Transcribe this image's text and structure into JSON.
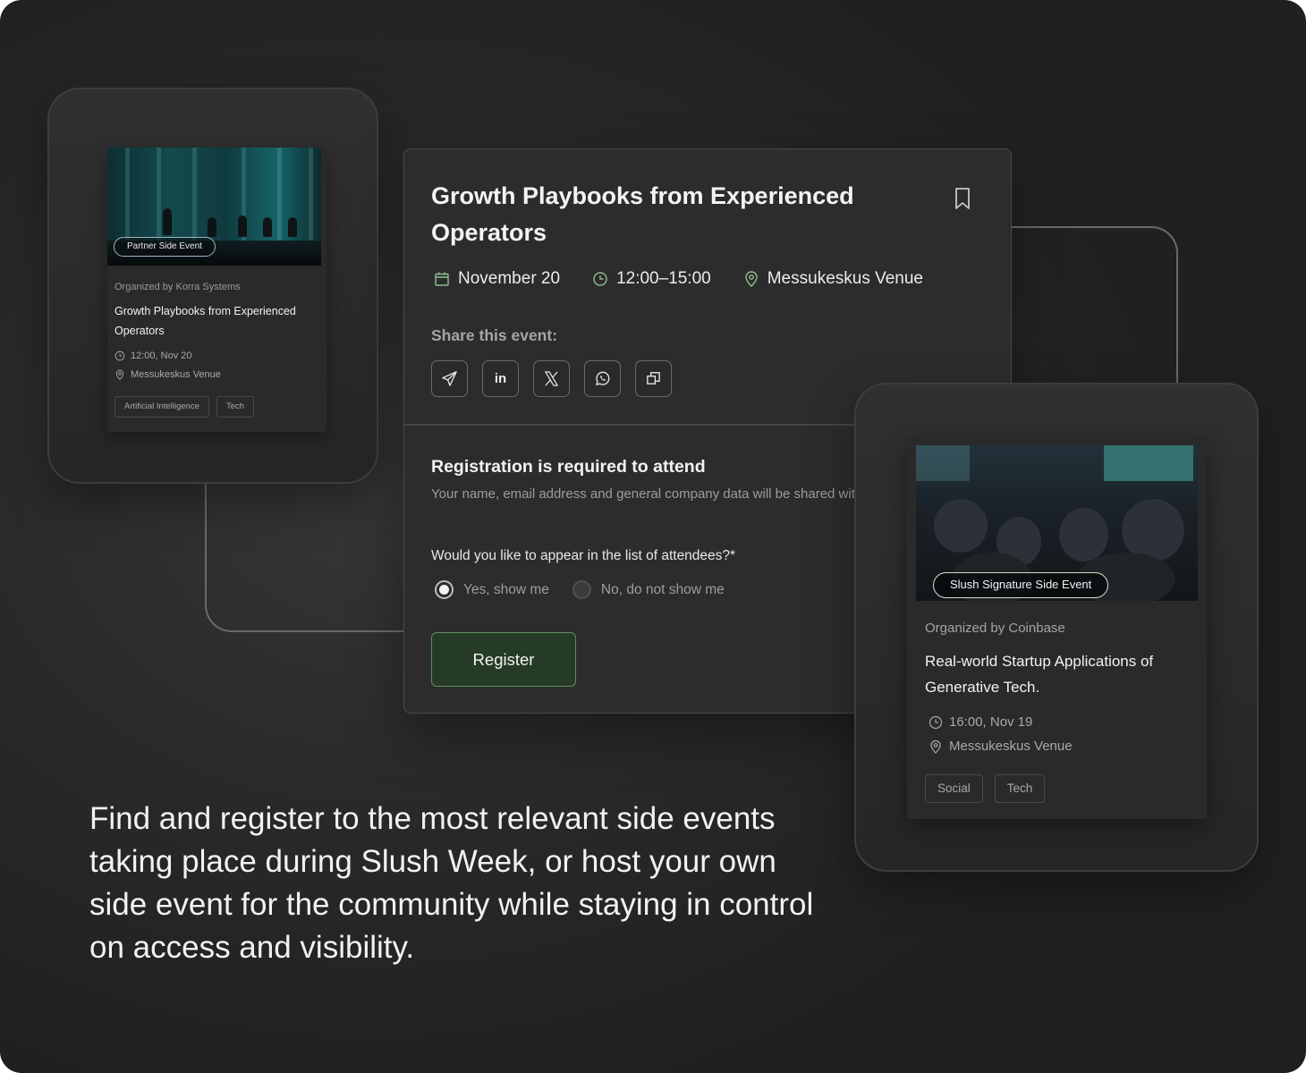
{
  "partner_card": {
    "badge": "Partner Side Event",
    "organizer": "Organized by Korra Systems",
    "title": "Growth Playbooks from Experienced Operators",
    "time": "12:00, Nov 20",
    "venue": "Messukeskus Venue",
    "tags": [
      "Artificial Intelligence",
      "Tech"
    ]
  },
  "event_panel": {
    "title": "Growth Playbooks from Experienced Operators",
    "date": "November 20",
    "time": "12:00–15:00",
    "venue": "Messukeskus Venue",
    "share_label": "Share this event:",
    "share_icons": [
      "telegram-icon",
      "linkedin-icon",
      "x-icon",
      "whatsapp-icon",
      "copy-link-icon"
    ],
    "linkedin_text": "in",
    "registration_title": "Registration is required to attend",
    "registration_desc": "Your name, email address and general company data will be shared with the organizer.",
    "question": "Would you like to appear in the list of attendees?*",
    "option_yes": "Yes, show me",
    "option_no": "No, do not show me",
    "selected_option": "yes",
    "register_label": "Register"
  },
  "signature_card": {
    "badge": "Slush Signature Side Event",
    "organizer": "Organized by Coinbase",
    "title": "Real-world Startup Applications of Generative Tech.",
    "time": "16:00, Nov 19",
    "venue": "Messukeskus Venue",
    "tags": [
      "Social",
      "Tech"
    ]
  },
  "tagline": "Find and register to the most relevant side events taking place during Slush Week, or host your own side event for the community while staying in control on access and visibility.",
  "colors": {
    "background": "#2a2a2b",
    "panel": "#2c2c2d",
    "register_button": "#253b26",
    "register_border": "#5f8f5e",
    "text_primary": "#f2f2f2",
    "text_muted": "#9d9d9d"
  }
}
